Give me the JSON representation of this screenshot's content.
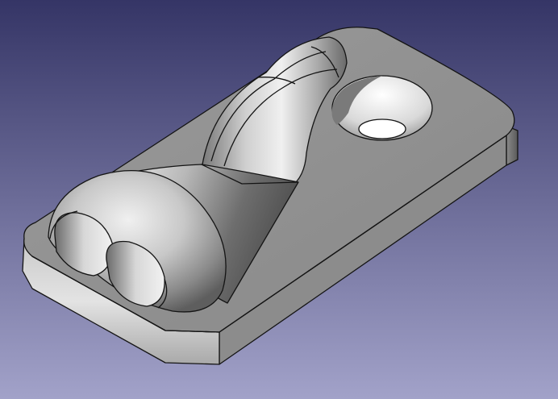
{
  "viewport": {
    "background_top": "#353566",
    "background_bottom": "#a2a2c9"
  },
  "model": {
    "name": "3d-cad-part",
    "face_color": "#8f8f8f",
    "edge_color": "#141414",
    "highlight_color": "#d8d8d8",
    "shadow_color": "#4a4a4a"
  }
}
